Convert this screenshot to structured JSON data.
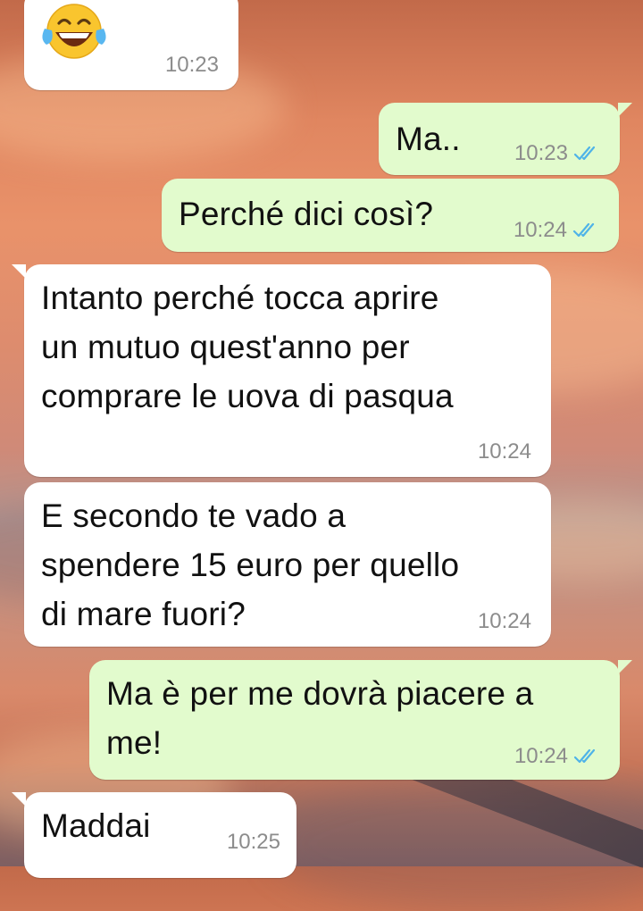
{
  "colors": {
    "incoming_bubble": "#ffffff",
    "outgoing_bubble": "#e2fbcd",
    "timestamp": "#8c8c8c",
    "read_ticks": "#4fb3e8"
  },
  "messages": [
    {
      "direction": "incoming",
      "emoji": "face-with-tears-of-joy",
      "time": "10:23"
    },
    {
      "direction": "outgoing",
      "text": "Ma..",
      "time": "10:23",
      "status": "read"
    },
    {
      "direction": "outgoing",
      "text": "Perché dici così?",
      "time": "10:24",
      "status": "read"
    },
    {
      "direction": "incoming",
      "lines": [
        "Intanto perché tocca aprire",
        "un mutuo quest'anno per",
        "comprare le uova di pasqua"
      ],
      "time": "10:24"
    },
    {
      "direction": "incoming",
      "lines": [
        "E secondo te vado a",
        "spendere 15 euro per quello",
        "di mare fuori?"
      ],
      "time": "10:24"
    },
    {
      "direction": "outgoing",
      "lines": [
        "Ma è per me dovrà piacere a",
        "me!"
      ],
      "time": "10:24",
      "status": "read"
    },
    {
      "direction": "incoming",
      "text": "Maddai",
      "time": "10:25"
    }
  ]
}
